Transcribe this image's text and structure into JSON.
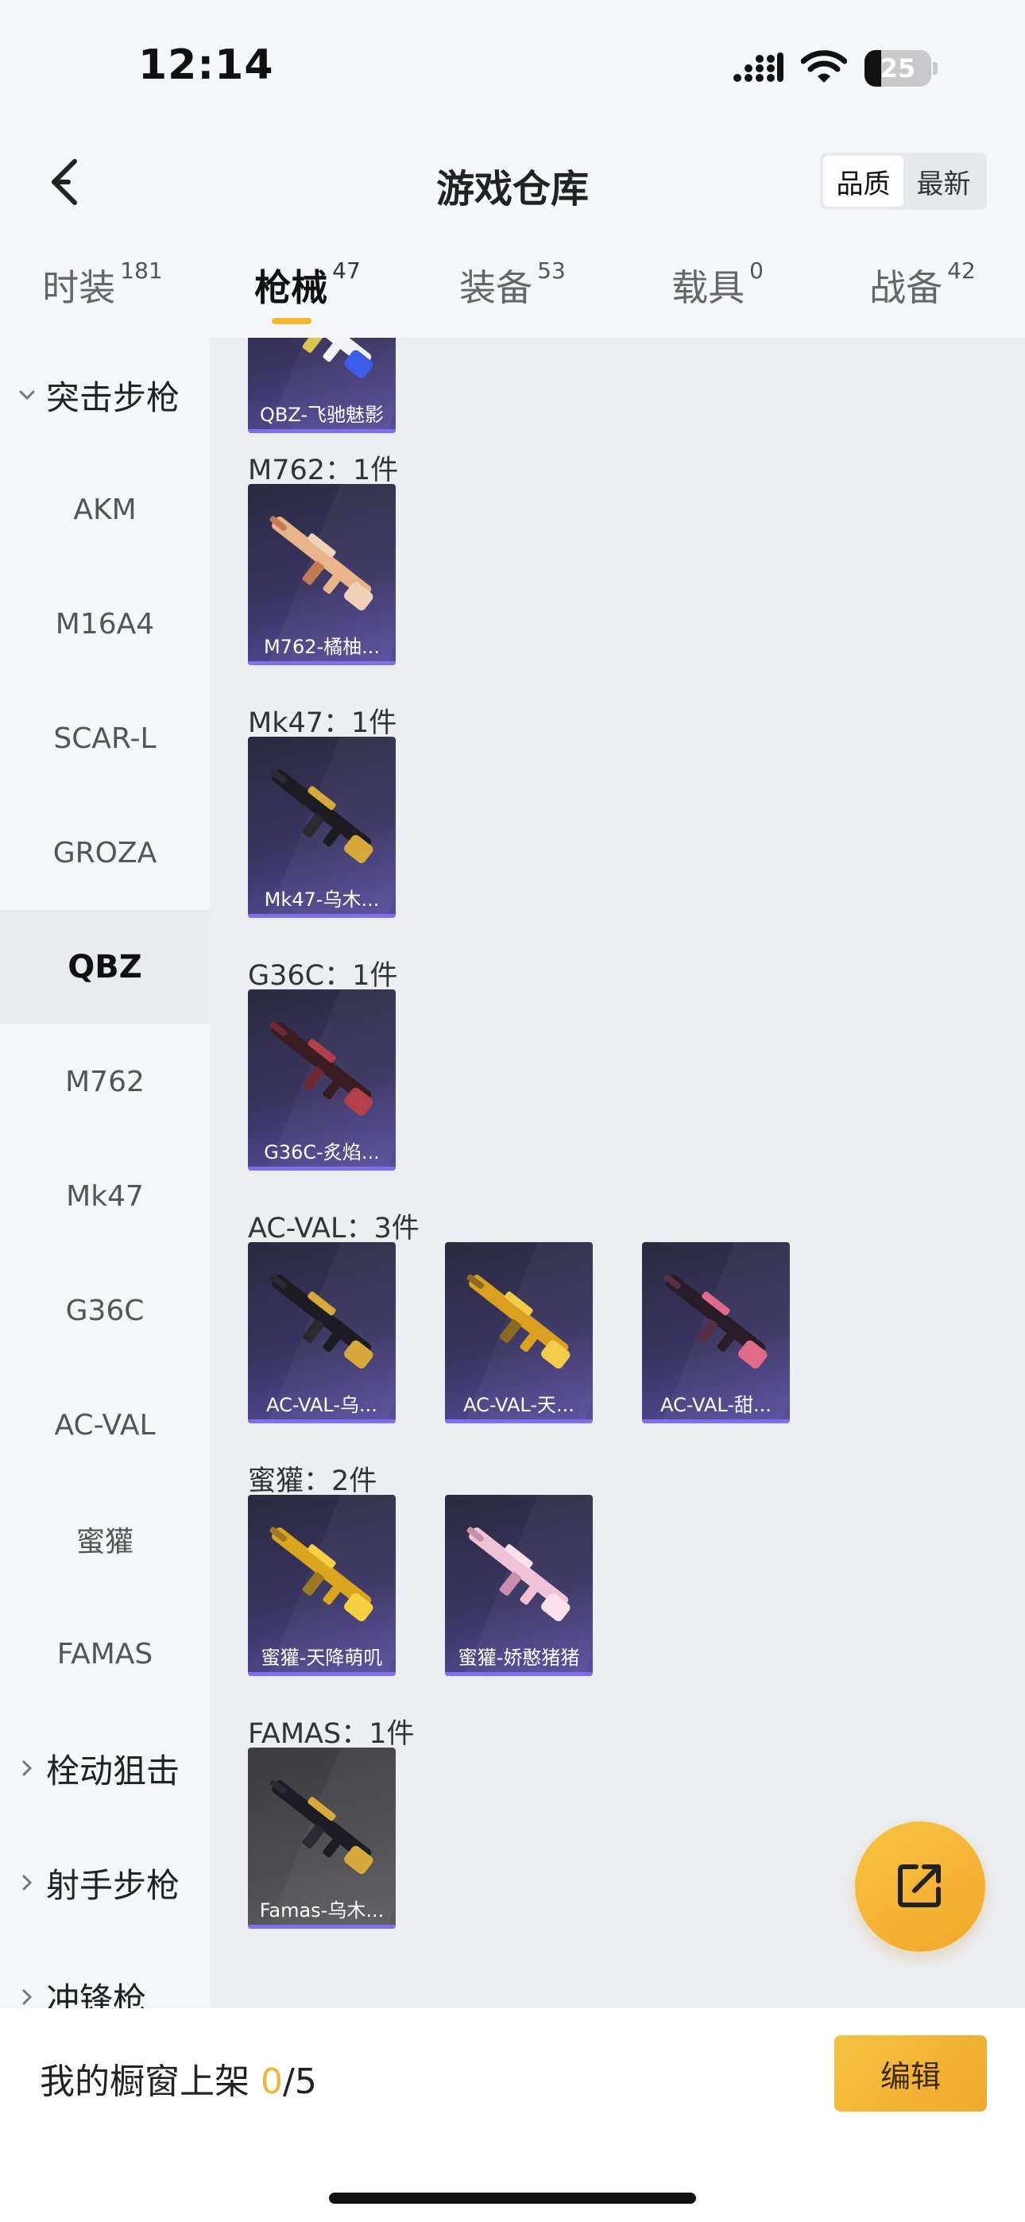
{
  "status_bar": {
    "time": "12:14",
    "battery": "25",
    "battery_level": 0.25
  },
  "header": {
    "title": "游戏仓库",
    "sort_options": [
      "品质",
      "最新"
    ],
    "active_sort": 0
  },
  "tabs": [
    {
      "label": "时装",
      "count": "181"
    },
    {
      "label": "枪械",
      "count": "47"
    },
    {
      "label": "装备",
      "count": "53"
    },
    {
      "label": "载具",
      "count": "0"
    },
    {
      "label": "战备",
      "count": "42"
    }
  ],
  "active_tab": 1,
  "sidebar": {
    "items": [
      {
        "label": "突击步枪",
        "type": "group",
        "expanded": true
      },
      {
        "label": "AKM"
      },
      {
        "label": "M16A4"
      },
      {
        "label": "SCAR-L"
      },
      {
        "label": "GROZA"
      },
      {
        "label": "QBZ",
        "active": true
      },
      {
        "label": "M762"
      },
      {
        "label": "Mk47"
      },
      {
        "label": "G36C"
      },
      {
        "label": "AC-VAL"
      },
      {
        "label": "蜜獾"
      },
      {
        "label": "FAMAS"
      },
      {
        "label": "栓动狙击",
        "type": "group"
      },
      {
        "label": "射手步枪",
        "type": "group"
      },
      {
        "label": "冲锋枪",
        "type": "group"
      }
    ]
  },
  "main": {
    "top_card": {
      "name": "QBZ-飞驰魅影"
    },
    "groups": [
      {
        "title": "M762：1件",
        "items": [
          {
            "name": "M762-橘柚..."
          }
        ]
      },
      {
        "title": "Mk47：1件",
        "items": [
          {
            "name": "Mk47-乌木..."
          }
        ]
      },
      {
        "title": "G36C：1件",
        "items": [
          {
            "name": "G36C-炙焰..."
          }
        ]
      },
      {
        "title": "AC-VAL：3件",
        "items": [
          {
            "name": "AC-VAL-乌..."
          },
          {
            "name": "AC-VAL-天..."
          },
          {
            "name": "AC-VAL-甜..."
          }
        ]
      },
      {
        "title": "蜜獾：2件",
        "items": [
          {
            "name": "蜜獾-天降萌叽"
          },
          {
            "name": "蜜獾-娇憨猪猪"
          }
        ]
      },
      {
        "title": "FAMAS：1件",
        "items": [
          {
            "name": "Famas-乌木..."
          }
        ]
      }
    ]
  },
  "bottom_bar": {
    "showcase_label": "我的橱窗上架",
    "showcase_current": "0",
    "showcase_total": "/5",
    "edit_label": "编辑"
  },
  "colors": {
    "accent": "#f5b731",
    "card_purple": "#3a3462",
    "card_underline": "#7f6ff0"
  },
  "icons": [
    "back-arrow-icon",
    "signal-icon",
    "wifi-icon",
    "battery-icon",
    "chevron-down-icon",
    "chevron-right-icon",
    "share-external-icon"
  ]
}
